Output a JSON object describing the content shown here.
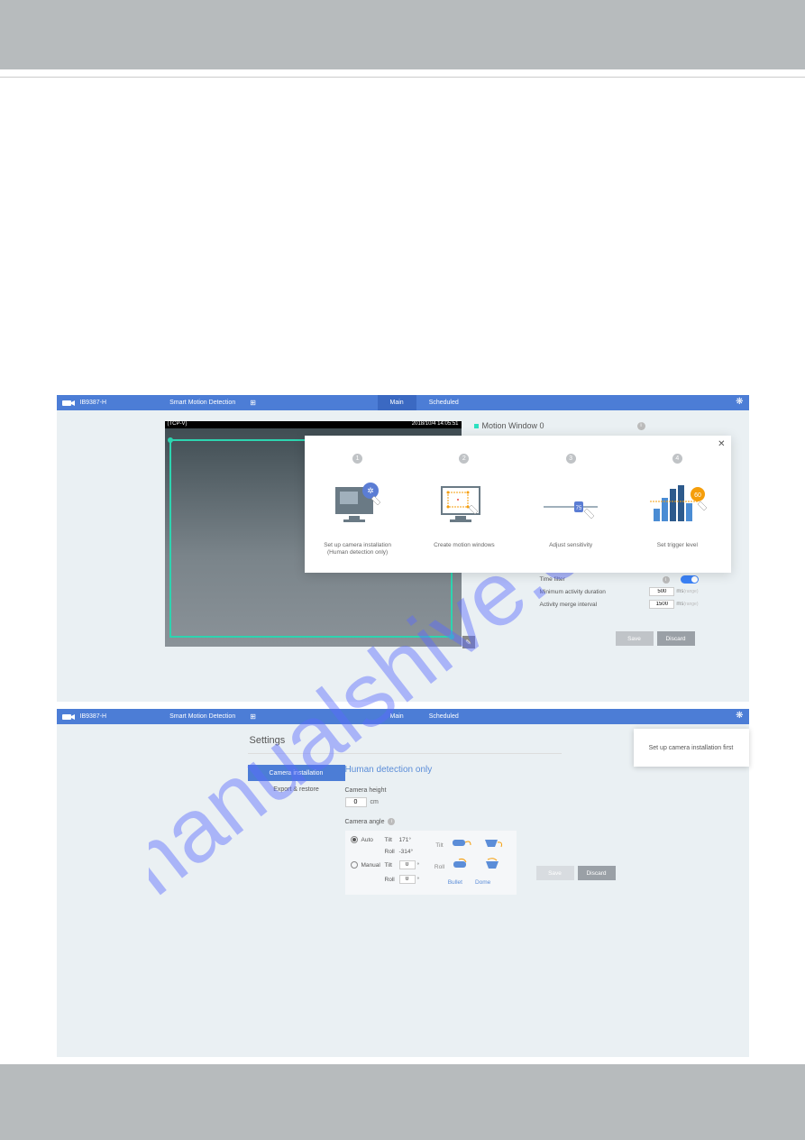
{
  "header": {
    "model": "IB9387-H",
    "app": "Smart Motion Detection",
    "tabs": {
      "main": "Main",
      "scheduled": "Scheduled"
    }
  },
  "shot1": {
    "video": {
      "src": "(TCP-V)",
      "timestamp": "2018/10/4 14:05:51"
    },
    "motionWindow": "Motion Window 0",
    "wizard": {
      "steps": [
        {
          "label": "Set up camera installation\n(Human detection only)"
        },
        {
          "label": "Create motion windows"
        },
        {
          "label": "Adjust sensitivity"
        },
        {
          "label": "Set trigger level"
        }
      ],
      "triggerBadge": "60"
    },
    "timeFilter": {
      "label": "Time filter",
      "minActivity": {
        "label": "Minimum activity duration",
        "value": "500",
        "unit": "ms",
        "range": "(range)"
      },
      "mergeInterval": {
        "label": "Activity merge interval",
        "value": "1500",
        "unit": "ms",
        "range": "(range)"
      }
    },
    "buttons": {
      "save": "Save",
      "discard": "Discard"
    }
  },
  "shot2": {
    "settingsTitle": "Settings",
    "nav": {
      "camInstall": "Camera installation",
      "exportRestore": "Export & restore"
    },
    "hdo": "Human detection only",
    "cameraHeight": {
      "label": "Camera height",
      "value": "0",
      "unit": "cm"
    },
    "cameraAngle": {
      "label": "Camera angle",
      "auto": {
        "label": "Auto",
        "tilt": "Tilt",
        "tiltVal": "171°",
        "roll": "Roll",
        "rollVal": "-314°"
      },
      "manual": {
        "label": "Manual",
        "tilt": "Tilt",
        "tiltVal": "0",
        "roll": "Roll",
        "rollVal": "0"
      },
      "tiltRowLabel": "Tilt",
      "rollRowLabel": "Roll",
      "bullet": "Bullet",
      "dome": "Dome"
    },
    "buttons": {
      "save": "Save",
      "discard": "Discard"
    },
    "tooltip": "Set up camera installation first"
  }
}
